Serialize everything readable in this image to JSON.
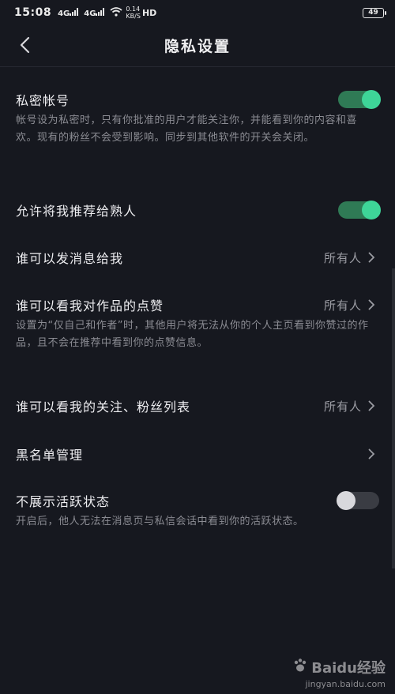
{
  "status_bar": {
    "time": "15:08",
    "signal1": "4G",
    "signal2": "4G",
    "speed_value": "0.14",
    "speed_unit": "KB/S",
    "hd": "HD",
    "battery": "49"
  },
  "nav": {
    "title": "隐私设置"
  },
  "settings": [
    {
      "title": "私密帐号",
      "toggle": "on",
      "description": "帐号设为私密时，只有你批准的用户才能关注你，并能看到你的内容和喜欢。现有的粉丝不会受到影响。同步到其他软件的开关会关闭。"
    },
    {
      "title": "允许将我推荐给熟人",
      "toggle": "on"
    },
    {
      "title": "谁可以发消息给我",
      "value": "所有人"
    },
    {
      "title": "谁可以看我对作品的点赞",
      "value": "所有人",
      "description": "设置为“仅自己和作者”时，其他用户将无法从你的个人主页看到你赞过的作品，且不会在推荐中看到你的点赞信息。"
    },
    {
      "title": "谁可以看我的关注、粉丝列表",
      "value": "所有人"
    },
    {
      "title": "黑名单管理"
    },
    {
      "title": "不展示活跃状态",
      "toggle": "off",
      "description": "开启后，他人无法在消息页与私信会话中看到你的活跃状态。"
    }
  ],
  "watermark": {
    "brand": "Baidu经验",
    "url": "jingyan.baidu.com"
  },
  "colors": {
    "background": "#16181f",
    "toggle_on": "#3ed598",
    "text_secondary": "#8b8c93"
  }
}
